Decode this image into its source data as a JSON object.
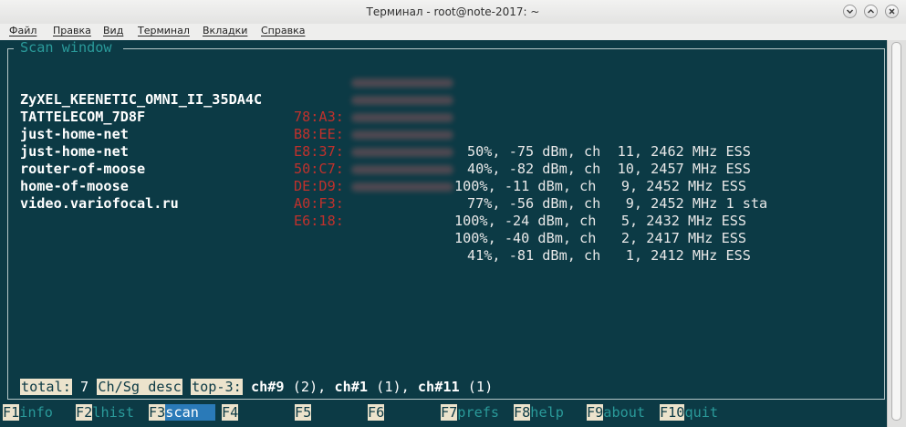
{
  "window": {
    "title": "Терминал - root@note-2017: ~",
    "buttons": [
      "minimize-icon",
      "maximize-icon",
      "close-icon"
    ]
  },
  "menubar": {
    "items": [
      {
        "label": "Файл"
      },
      {
        "label": "Правка"
      },
      {
        "label": "Вид"
      },
      {
        "label": "Терминал"
      },
      {
        "label": "Вкладки"
      },
      {
        "label": "Справка"
      }
    ]
  },
  "scan": {
    "title": "Scan window",
    "networks": [
      {
        "ssid": "ZyXEL_KEENETIC_OMNI_II_35DA4C",
        "mac": "78:A3:",
        "stats": "50%, -75 dBm, ch  11, 2462 MHz ESS"
      },
      {
        "ssid": "TATTELECOM_7D8F",
        "mac": "B8:EE:",
        "stats": "40%, -82 dBm, ch  10, 2457 MHz ESS"
      },
      {
        "ssid": "just-home-net",
        "mac": "E8:37:",
        "stats": "100%, -11 dBm, ch   9, 2452 MHz ESS"
      },
      {
        "ssid": "just-home-net",
        "mac": "50:C7:",
        "stats": "77%, -56 dBm, ch   9, 2452 MHz 1 sta"
      },
      {
        "ssid": "router-of-moose",
        "mac": "DE:D9:",
        "stats": "100%, -24 dBm, ch   5, 2432 MHz ESS"
      },
      {
        "ssid": "home-of-moose",
        "mac": "A0:F3:",
        "stats": "100%, -40 dBm, ch   2, 2417 MHz ESS"
      },
      {
        "ssid": "video.variofocal.ru",
        "mac": "E6:18:",
        "stats": "41%, -81 dBm, ch   1, 2412 MHz ESS"
      }
    ]
  },
  "status": {
    "total_label": "total:",
    "total_value": "7",
    "sort_label": "Ch/Sg desc",
    "top_label": "top-3:",
    "top": [
      {
        "ch": "ch#9",
        "count": "(2)"
      },
      {
        "ch": "ch#1",
        "count": "(1)"
      },
      {
        "ch": "ch#11",
        "count": "(1)"
      }
    ]
  },
  "fkeys": [
    {
      "key": "F1",
      "label": "info"
    },
    {
      "key": "F2",
      "label": "lhist"
    },
    {
      "key": "F3",
      "label": "scan  "
    },
    {
      "key": "F4",
      "label": ""
    },
    {
      "key": "F5",
      "label": ""
    },
    {
      "key": "F6",
      "label": ""
    },
    {
      "key": "F7",
      "label": "prefs"
    },
    {
      "key": "F8",
      "label": "help"
    },
    {
      "key": "F9",
      "label": "about"
    },
    {
      "key": "F10",
      "label": "quit"
    }
  ],
  "active_fkey": "F3",
  "colors": {
    "terminal_bg": "#0c3a45",
    "mac": "#c0312c",
    "title": "#2a9a9a",
    "highlight": "#ece3cc",
    "active": "#2a7ab8"
  }
}
